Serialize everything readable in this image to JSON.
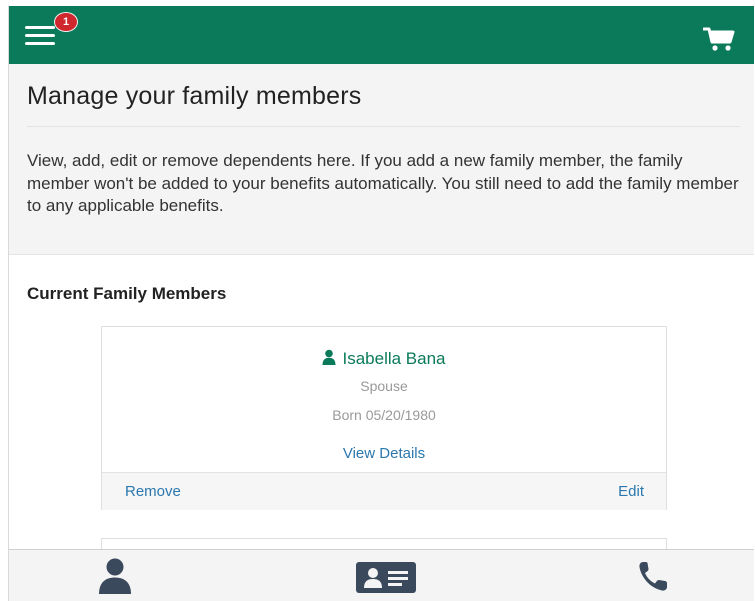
{
  "header": {
    "notification_count": "1",
    "menu_icon": "hamburger-menu-icon",
    "cart_icon": "shopping-cart-icon"
  },
  "page": {
    "title": "Manage your family members",
    "description": "View, add, edit or remove dependents here. If you add a new family member, the family member won't be added to your benefits automatically. You still need to add the family member to any applicable benefits."
  },
  "family": {
    "section_label": "Current Family Members",
    "members": [
      {
        "name": "Isabella Bana",
        "relationship": "Spouse",
        "born": "Born 05/20/1980",
        "view_details_label": "View Details",
        "remove_label": "Remove",
        "edit_label": "Edit"
      }
    ]
  },
  "bottom_nav": {
    "items": [
      {
        "icon": "person-icon"
      },
      {
        "icon": "id-card-icon"
      },
      {
        "icon": "phone-icon"
      }
    ]
  },
  "colors": {
    "brand_green": "#0b7a5a",
    "link_blue": "#2a78ad",
    "badge_red": "#d0262d",
    "nav_icon": "#3a4a5c"
  }
}
